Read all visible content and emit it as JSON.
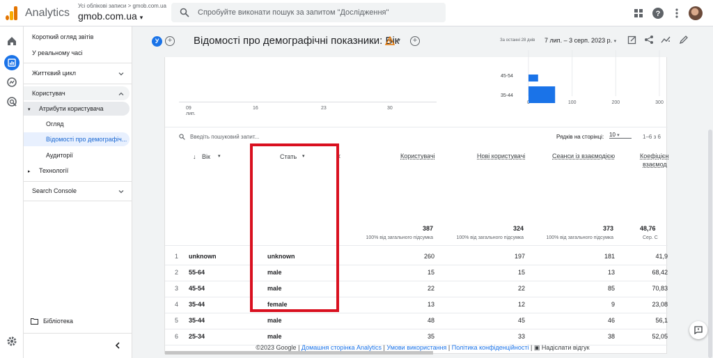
{
  "topbar": {
    "app_name": "Analytics",
    "account_line": "Усі облікові записи > gmob.com.ua",
    "property": "gmob.com.ua",
    "search_placeholder": "Спробуйте виконати пошук за запитом \"Дослідження\""
  },
  "nav": {
    "items": [
      {
        "label": "Короткий огляд звітів"
      },
      {
        "label": "У реальному часі"
      },
      {
        "label": "Життєвий цикл"
      },
      {
        "label": "Користувач"
      },
      {
        "label": "Атрибути користувача"
      },
      {
        "label": "Огляд"
      },
      {
        "label": "Відомості про демографіч..."
      },
      {
        "label": "Аудиторії"
      },
      {
        "label": "Технології"
      },
      {
        "label": "Search Console"
      }
    ],
    "library": "Бібліотека"
  },
  "header": {
    "segment_chip": "У",
    "title": "Відомості про демографічні показники: Вік",
    "date_note": "За останні 28 днів",
    "date_range": "7 лип. – 3 серп. 2023 р."
  },
  "chart_left": {
    "x_ticks": [
      "09",
      "16",
      "23",
      "30"
    ],
    "x_sub": "лип."
  },
  "chart_right": {
    "type": "bar",
    "categories": [
      "45-54",
      "35-44"
    ],
    "values": [
      22,
      61
    ],
    "xlim": [
      0,
      300
    ],
    "x_ticks": [
      "0",
      "100",
      "200",
      "300"
    ]
  },
  "toolbar": {
    "search_placeholder": "Введіть пошуковий запит...",
    "rows_per_page_label": "Рядків на сторінці:",
    "rows_per_page_value": "10",
    "pagination": "1–6 з 6"
  },
  "table": {
    "col_age": "Вік",
    "col_gender": "Стать",
    "col_users": "Користувачі",
    "col_new_users": "Нові користувачі",
    "col_sessions": "Сеанси із взаємодією",
    "col_avg_line1": "Коефіцієн",
    "col_avg_line2": "взаємод",
    "totals": {
      "users": "387",
      "new_users": "324",
      "sessions": "373",
      "avg": "48,76",
      "pct_label": "100% від загального підсумка",
      "avg_label": "Сер. С"
    },
    "rows": [
      {
        "n": "1",
        "age": "unknown",
        "gender": "unknown",
        "users": "260",
        "new": "197",
        "sessions": "181",
        "rate": "41,9"
      },
      {
        "n": "2",
        "age": "55-64",
        "gender": "male",
        "users": "15",
        "new": "15",
        "sessions": "13",
        "rate": "68,42"
      },
      {
        "n": "3",
        "age": "45-54",
        "gender": "male",
        "users": "22",
        "new": "22",
        "sessions": "85",
        "rate": "70,83"
      },
      {
        "n": "4",
        "age": "35-44",
        "gender": "female",
        "users": "13",
        "new": "12",
        "sessions": "9",
        "rate": "23,08"
      },
      {
        "n": "5",
        "age": "35-44",
        "gender": "male",
        "users": "48",
        "new": "45",
        "sessions": "46",
        "rate": "56,1"
      },
      {
        "n": "6",
        "age": "25-34",
        "gender": "male",
        "users": "35",
        "new": "33",
        "sessions": "38",
        "rate": "52,05"
      }
    ]
  },
  "footer": {
    "copyright": "©2023 Google",
    "home": "Домашня сторінка Analytics",
    "terms": "Умови використання",
    "privacy": "Політика конфіденційності",
    "feedback": "Надіслати відгук"
  },
  "colors": {
    "accent": "#1a73e8",
    "highlight": "#d9101f",
    "selected_nav": "#e8f0fe"
  }
}
